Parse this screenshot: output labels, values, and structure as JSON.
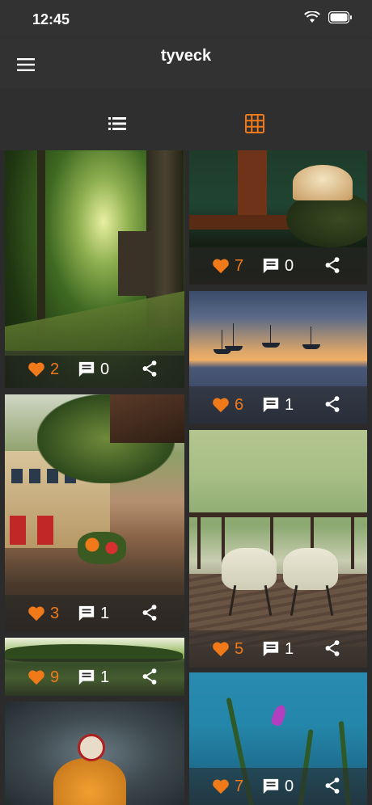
{
  "status_bar": {
    "time": "12:45"
  },
  "app_bar": {
    "title": "tyveck"
  },
  "colors": {
    "accent": "#f07a1a",
    "app_bar": "#323232",
    "background": "#2b2b2b"
  },
  "view_toggle": {
    "list_icon": "list-icon",
    "grid_icon": "grid-icon",
    "active": "grid"
  },
  "posts": [
    {
      "name": "post-forest",
      "likes": "2",
      "comments": "0"
    },
    {
      "name": "post-lamp",
      "likes": "7",
      "comments": "0"
    },
    {
      "name": "post-sunset",
      "likes": "6",
      "comments": "1"
    },
    {
      "name": "post-cafe",
      "likes": "3",
      "comments": "1"
    },
    {
      "name": "post-chairs",
      "likes": "5",
      "comments": "1"
    },
    {
      "name": "post-meadow",
      "likes": "9",
      "comments": "1"
    },
    {
      "name": "post-underwater",
      "likes": "7",
      "comments": "0"
    }
  ]
}
